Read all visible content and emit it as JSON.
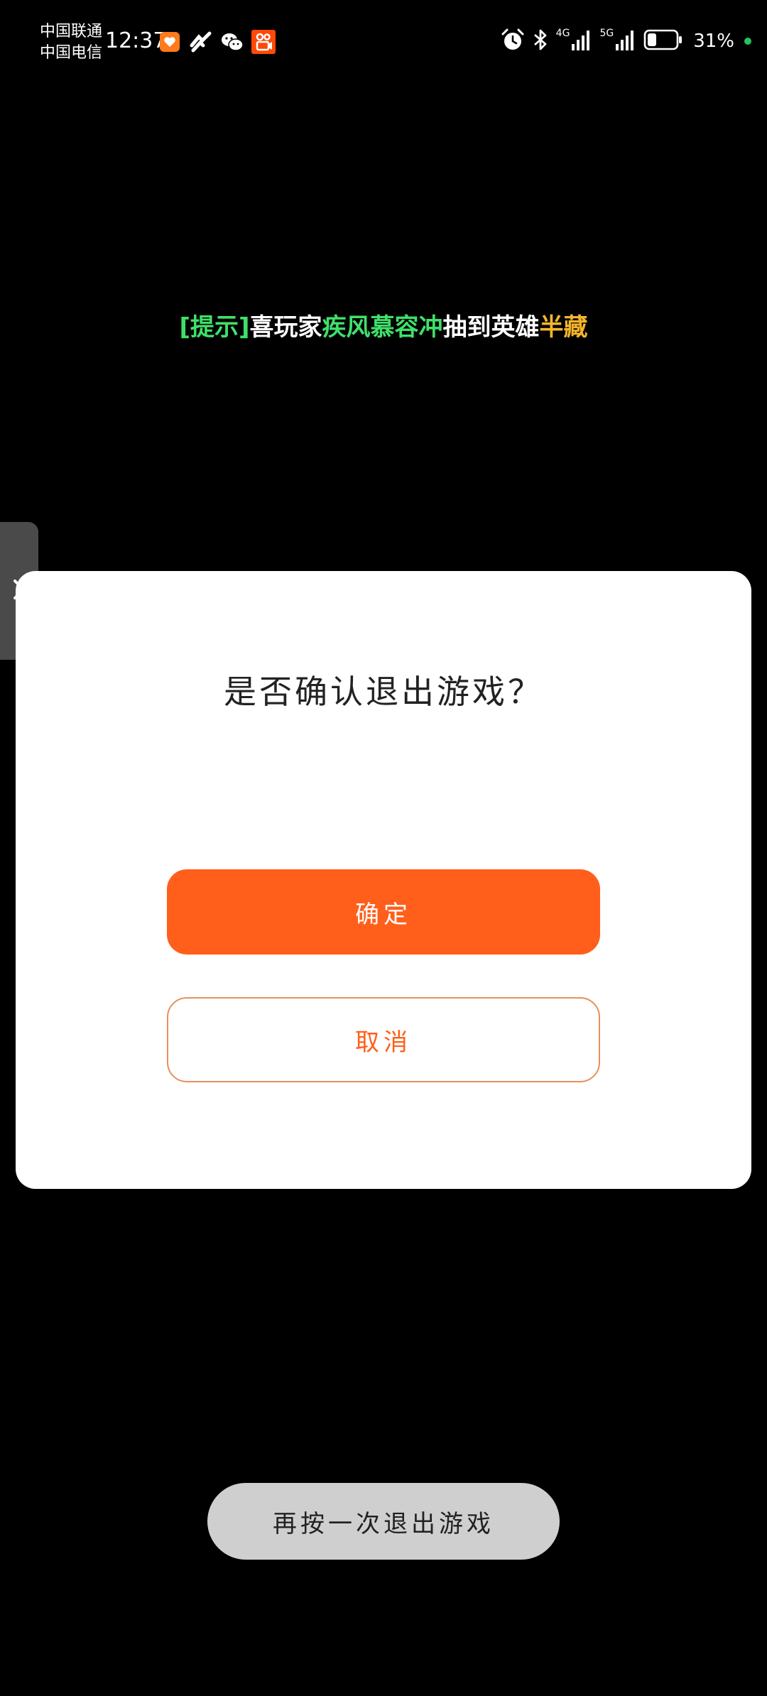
{
  "status_bar": {
    "carrier_1": "中国联通",
    "carrier_2": "中国电信",
    "time": "12:37",
    "notification_icons": [
      "health-app-icon",
      "link-app-icon",
      "wechat-icon",
      "kuaishou-icon"
    ],
    "net_1": "4G",
    "net_2": "5G",
    "battery_percent": "31%",
    "battery_level": 0.31
  },
  "tip": {
    "tag": "[提示]",
    "seg_1": "喜玩家",
    "player_name": "疾风慕容冲",
    "seg_2": "抽到英雄",
    "hero_name": "半藏"
  },
  "dialog": {
    "title": "是否确认退出游戏？",
    "confirm_label": "确定",
    "cancel_label": "取消"
  },
  "toast": {
    "text": "再按一次退出游戏"
  },
  "colors": {
    "accent": "#ff5f1a",
    "tip_green": "#3fe06a",
    "tip_gold": "#f5b52b",
    "charging": "#22c55e"
  }
}
